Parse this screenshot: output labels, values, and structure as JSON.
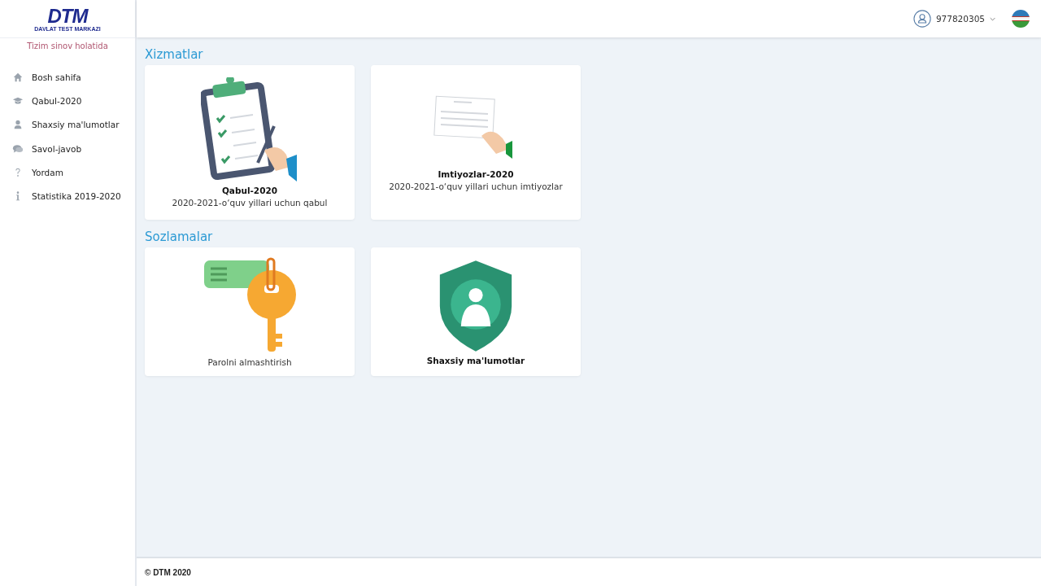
{
  "logo": {
    "mark": "DTM",
    "subtitle": "DAVLAT TEST MARKAZI"
  },
  "sidebar": {
    "notice": "Tizim sinov holatida",
    "items": [
      {
        "kind": "home",
        "label": "Bosh sahifa"
      },
      {
        "kind": "cap",
        "label": "Qabul-2020"
      },
      {
        "kind": "user",
        "label": "Shaxsiy ma'lumotlar"
      },
      {
        "kind": "chat",
        "label": "Savol-javob"
      },
      {
        "kind": "question",
        "label": "Yordam"
      },
      {
        "kind": "info",
        "label": "Statistika 2019-2020"
      }
    ]
  },
  "header": {
    "user": "977820305"
  },
  "sections": [
    {
      "title": "Xizmatlar",
      "cards": [
        {
          "kind": "clipboard",
          "title": "Qabul-2020",
          "subtitle": "2020-2021-o‘quv yillari uchun qabul"
        },
        {
          "kind": "certificate",
          "title": "Imtiyozlar-2020",
          "subtitle": "2020-2021-o‘quv yillari uchun imtiyozlar"
        }
      ]
    },
    {
      "title": "Sozlamalar",
      "cards": [
        {
          "kind": "key",
          "subtitle": "Parolni almashtirish"
        },
        {
          "kind": "shield",
          "title": "Shaxsiy ma'lumotlar"
        }
      ]
    }
  ],
  "footer": {
    "copyright": "© DTM 2020"
  }
}
